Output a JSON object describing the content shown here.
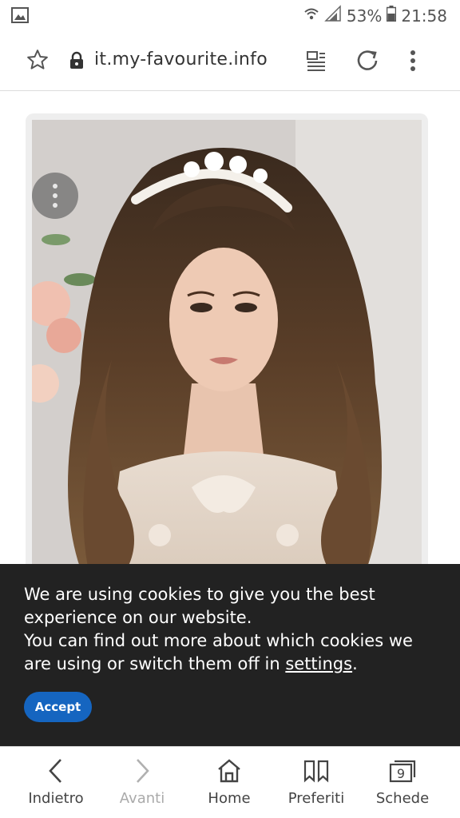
{
  "status_bar": {
    "battery": "53%",
    "time": "21:58"
  },
  "address_bar": {
    "url": "it.my-favourite.info"
  },
  "cookie_banner": {
    "line1": "We are using cookies to give you the best experience on our website.",
    "line2_prefix": "You can find out more about which cookies we are using or switch them off in ",
    "settings_link": "settings",
    "line2_suffix": ".",
    "accept_label": "Accept",
    "accept_color": "#1565c0"
  },
  "bottom_nav": {
    "back_label": "Indietro",
    "forward_label": "Avanti",
    "home_label": "Home",
    "bookmarks_label": "Preferiti",
    "tabs_label": "Schede",
    "tab_count": "9"
  }
}
